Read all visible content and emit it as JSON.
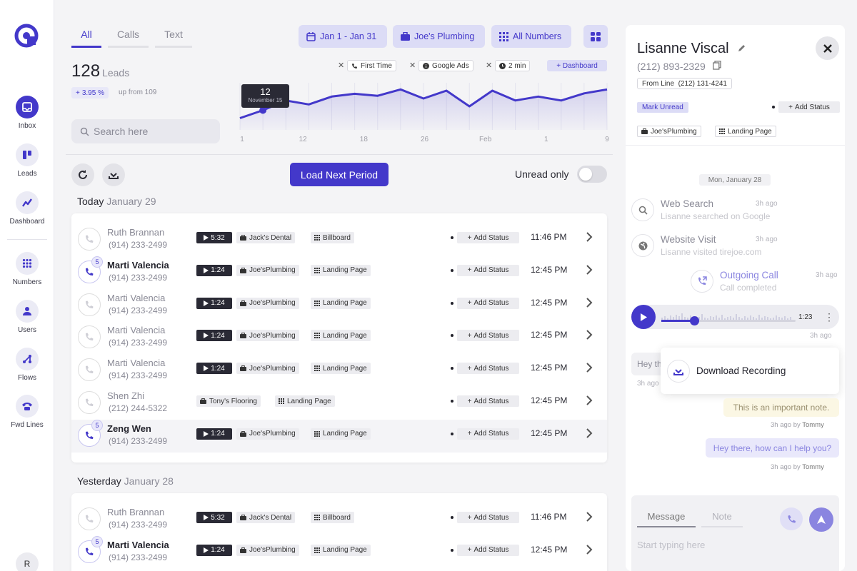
{
  "colors": {
    "accent": "#4338ca",
    "accent_light": "#dcdcf6",
    "note_bg": "#fbf7e4"
  },
  "sidebar": {
    "items": [
      {
        "label": "Inbox",
        "icon": "inbox-icon",
        "active": true
      },
      {
        "label": "Leads",
        "icon": "leads-icon"
      },
      {
        "label": "Dashboard",
        "icon": "dashboard-icon"
      },
      {
        "label": "Numbers",
        "icon": "numbers-grid-icon"
      },
      {
        "label": "Users",
        "icon": "user-icon"
      },
      {
        "label": "Flows",
        "icon": "flows-icon"
      },
      {
        "label": "Fwd Lines",
        "icon": "phone-forward-icon"
      }
    ],
    "avatar_initial": "R"
  },
  "tabs": [
    {
      "label": "All",
      "active": true
    },
    {
      "label": "Calls"
    },
    {
      "label": "Text"
    }
  ],
  "filters": {
    "date_range": "Jan 1 - Jan 31",
    "company": "Joe's Plumbing",
    "numbers": "All Numbers"
  },
  "stats": {
    "count": "128",
    "count_label": "Leads",
    "trend": "3.95 %",
    "trend_sub": "up from 109"
  },
  "search": {
    "placeholder": "Search here"
  },
  "chart_filters": [
    "First Time",
    "Google Ads",
    "2 min"
  ],
  "dashboard_link": "Dashboard",
  "chart_data": {
    "type": "area",
    "x_ticks": [
      "1",
      "12",
      "18",
      "26",
      "Feb",
      "1",
      "9"
    ],
    "values": [
      3,
      5,
      7.5,
      6.5,
      8.5,
      9.2,
      8.7,
      10.3,
      8,
      10,
      6,
      10,
      7.5,
      8.5,
      7.5,
      9.3,
      10.3
    ],
    "ylim": [
      0,
      12
    ],
    "tooltip": {
      "value": "12",
      "date": "November 15"
    },
    "highlight_index": 1
  },
  "actions": {
    "load_next": "Load Next Period",
    "unread_only": "Unread only"
  },
  "sections": [
    {
      "day": "Today",
      "date": "January 29",
      "rows": [
        {
          "name": "Ruth Brannan",
          "phone": "(914) 233-2499",
          "duration": "5:32",
          "tags": [
            "Jack's Dental",
            "Billboard"
          ],
          "status": "Add Status",
          "time": "11:46 PM",
          "count": "",
          "bold": false
        },
        {
          "name": "Marti Valencia",
          "phone": "(914) 233-2499",
          "duration": "1:24",
          "tags": [
            "Joe'sPlumbing",
            "Landing Page"
          ],
          "status": "Add Status",
          "time": "12:45 PM",
          "count": "5",
          "bold": true
        },
        {
          "name": "Marti Valencia",
          "phone": "(914) 233-2499",
          "duration": "1:24",
          "tags": [
            "Joe'sPlumbing",
            "Landing Page"
          ],
          "status": "Add Status",
          "time": "12:45 PM",
          "count": "",
          "bold": false
        },
        {
          "name": "Marti Valencia",
          "phone": "(914) 233-2499",
          "duration": "1:24",
          "tags": [
            "Joe'sPlumbing",
            "Landing Page"
          ],
          "status": "Add Status",
          "time": "12:45 PM",
          "count": "",
          "bold": false
        },
        {
          "name": "Marti Valencia",
          "phone": "(914) 233-2499",
          "duration": "1:24",
          "tags": [
            "Joe'sPlumbing",
            "Landing Page"
          ],
          "status": "Add Status",
          "time": "12:45 PM",
          "count": "",
          "bold": false
        },
        {
          "name": "Shen Zhi",
          "phone": "(212) 244-5322",
          "duration": "",
          "tags": [
            "Tony's Flooring",
            "Landing Page"
          ],
          "status": "Add Status",
          "time": "12:45 PM",
          "count": "",
          "bold": false
        },
        {
          "name": "Zeng Wen",
          "phone": "(914) 233-2499",
          "duration": "1:24",
          "tags": [
            "Joe'sPlumbing",
            "Landing Page"
          ],
          "status": "Add Status",
          "time": "12:45 PM",
          "count": "5",
          "bold": true,
          "selected": true
        }
      ]
    },
    {
      "day": "Yesterday",
      "date": "January 28",
      "rows": [
        {
          "name": "Ruth Brannan",
          "phone": "(914) 233-2499",
          "duration": "5:32",
          "tags": [
            "Jack's Dental",
            "Billboard"
          ],
          "status": "Add Status",
          "time": "11:46 PM",
          "count": "",
          "bold": false
        },
        {
          "name": "Marti Valencia",
          "phone": "(914) 233-2499",
          "duration": "1:24",
          "tags": [
            "Joe'sPlumbing",
            "Landing Page"
          ],
          "status": "Add Status",
          "time": "12:45 PM",
          "count": "5",
          "bold": true
        }
      ]
    }
  ],
  "contact": {
    "name": "Lisanne Viscal",
    "phone": "(212) 893-2329",
    "from_line_label": "From Line",
    "from_line_number": "(212) 131-4241",
    "mark_unread": "Mark Unread",
    "add_status": "Add Status",
    "tags": [
      "Joe'sPlumbing",
      "Landing Page"
    ]
  },
  "timeline": {
    "date_chip": "Mon, January 28",
    "events": [
      {
        "title": "Web Search",
        "sub": "Lisanne searched on Google",
        "ago": "3h ago"
      },
      {
        "title": "Website Visit",
        "sub": "Lisanne visited tirejoe.com",
        "ago": "3h ago"
      },
      {
        "title": "Outgoing Call",
        "sub": "Call completed",
        "ago": "3h ago"
      }
    ],
    "player": {
      "duration": "1:23",
      "progress": 0.22,
      "ago": "3h ago"
    },
    "partial_message": "Hey th",
    "partial_ago": "3h ago",
    "download_label": "Download Recording",
    "note": "This is an important note.",
    "note_meta": {
      "ago": "3h ago by",
      "author": "Tommy"
    },
    "reply": "Hey there, how can I help you?",
    "reply_meta": {
      "ago": "3h ago by",
      "author": "Tommy"
    }
  },
  "compose": {
    "tab_message": "Message",
    "tab_note": "Note",
    "placeholder": "Start typing here"
  }
}
